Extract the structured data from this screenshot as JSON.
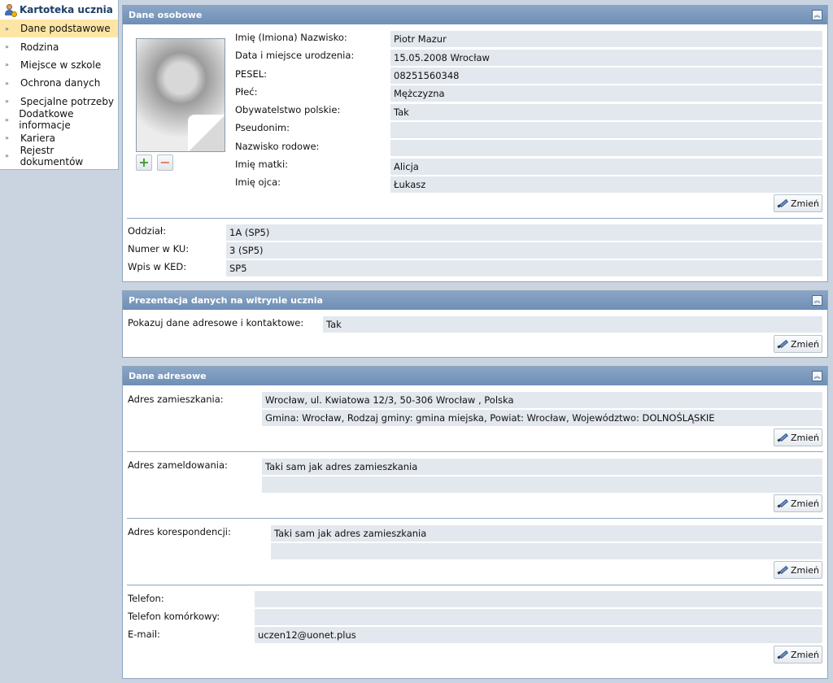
{
  "sidebar": {
    "title": "Kartoteka ucznia",
    "items": [
      {
        "label": "Dane podstawowe",
        "active": true
      },
      {
        "label": "Rodzina"
      },
      {
        "label": "Miejsce w szkole"
      },
      {
        "label": "Ochrona danych"
      },
      {
        "label": "Specjalne potrzeby"
      },
      {
        "label": "Dodatkowe informacje"
      },
      {
        "label": "Kariera"
      },
      {
        "label": "Rejestr dokumentów"
      }
    ],
    "chevron": "»"
  },
  "personal": {
    "title": "Dane osobowe",
    "fields": [
      {
        "label": "Imię (Imiona) Nazwisko:",
        "value": "Piotr Mazur"
      },
      {
        "label": "Data i miejsce urodzenia:",
        "value": "15.05.2008 Wrocław"
      },
      {
        "label": "PESEL:",
        "value": "08251560348"
      },
      {
        "label": "Płeć:",
        "value": "Mężczyzna"
      },
      {
        "label": "Obywatelstwo polskie:",
        "value": "Tak"
      },
      {
        "label": "Pseudonim:",
        "value": ""
      },
      {
        "label": "Nazwisko rodowe:",
        "value": ""
      },
      {
        "label": "Imię matki:",
        "value": "Alicja"
      },
      {
        "label": "Imię ojca:",
        "value": "Łukasz"
      }
    ],
    "class_fields": [
      {
        "label": "Oddział:",
        "value": "1A (SP5)"
      },
      {
        "label": "Numer w KU:",
        "value": "3 (SP5)"
      },
      {
        "label": "Wpis w KED:",
        "value": "SP5"
      }
    ],
    "add_icon": "+",
    "remove_icon": "−"
  },
  "presentation": {
    "title": "Prezentacja danych na witrynie ucznia",
    "label": "Pokazuj dane adresowe i kontaktowe:",
    "value": "Tak"
  },
  "address": {
    "title": "Dane adresowe",
    "residence_label": "Adres zamieszkania:",
    "residence_line1": "Wrocław, ul. Kwiatowa 12/3, 50-306 Wrocław , Polska",
    "residence_line2": "Gmina: Wrocław, Rodzaj gminy: gmina miejska, Powiat: Wrocław, Województwo: DOLNOŚLĄSKIE",
    "registration_label": "Adres zameldowania:",
    "registration_line1": "Taki sam jak adres zamieszkania",
    "registration_line2": "",
    "correspondence_label": "Adres korespondencji:",
    "correspondence_line1": "Taki sam jak adres zamieszkania",
    "correspondence_line2": "",
    "phone_label": "Telefon:",
    "phone_value": "",
    "mobile_label": "Telefon komórkowy:",
    "mobile_value": "",
    "email_label": "E-mail:",
    "email_value": "uczen12@uonet.plus"
  },
  "buttons": {
    "edit_label": "Zmień"
  },
  "collapse_icon": "︽"
}
